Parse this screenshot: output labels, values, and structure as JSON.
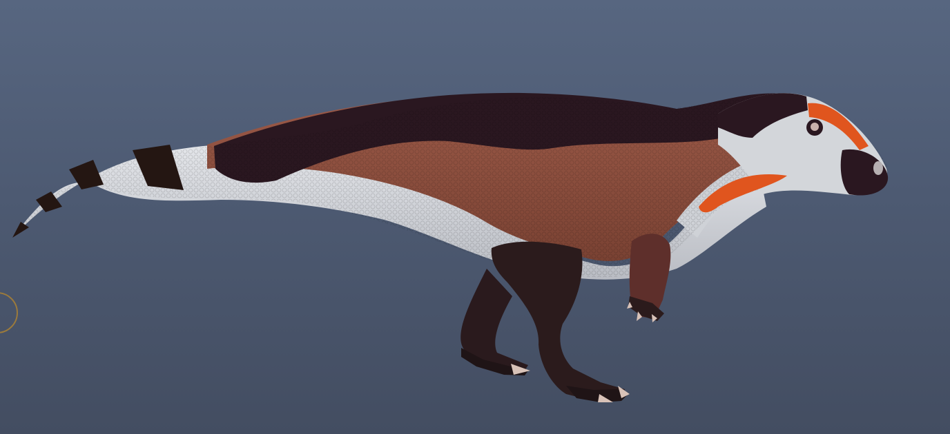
{
  "viewer": {
    "background_top": "#576680",
    "background_bottom": "#434d61"
  },
  "model": {
    "subject": "dinosaur-model",
    "palette": {
      "dark_back": "#2a1720",
      "body_brown": "#8a4e3e",
      "belly_white": "#d6d8dc",
      "tail_band_dark": "#241612",
      "face_orange": "#e0551e",
      "leg_dark": "#2b1b1c",
      "claw": "#d8c2b8"
    }
  },
  "cursor": {
    "icon": "orbit-cursor-icon",
    "color": "#9b7a3c"
  }
}
